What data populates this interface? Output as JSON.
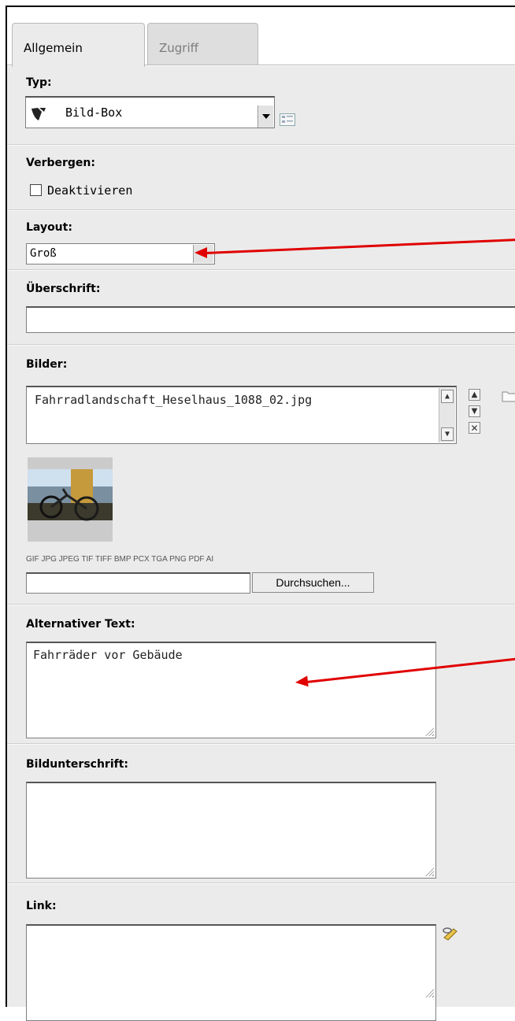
{
  "tabs": [
    {
      "label": "Allgemein",
      "active": true
    },
    {
      "label": "Zugriff",
      "active": false
    }
  ],
  "typ": {
    "label": "Typ:",
    "value": "Bild-Box"
  },
  "verbergen": {
    "label": "Verbergen:",
    "checkbox_label": "Deaktivieren",
    "checked": false
  },
  "layout": {
    "label": "Layout:",
    "value": "Groß"
  },
  "ueberschrift": {
    "label": "Überschrift:",
    "value": ""
  },
  "bilder": {
    "label": "Bilder:",
    "file": "Fahrradlandschaft_Heselhaus_1088_02.jpg",
    "allowed_types": "GIF JPG JPEG TIF TIFF BMP PCX TGA PNG PDF AI",
    "browse_label": "Durchsuchen..."
  },
  "alt_text": {
    "label": "Alternativer Text:",
    "value": "Fahrräder vor Gebäude"
  },
  "bildunterschrift": {
    "label": "Bildunterschrift:",
    "value": ""
  },
  "link": {
    "label": "Link:",
    "value": ""
  },
  "colors": {
    "annotation_arrow": "#e00000",
    "panel_bg": "#ebebeb"
  }
}
